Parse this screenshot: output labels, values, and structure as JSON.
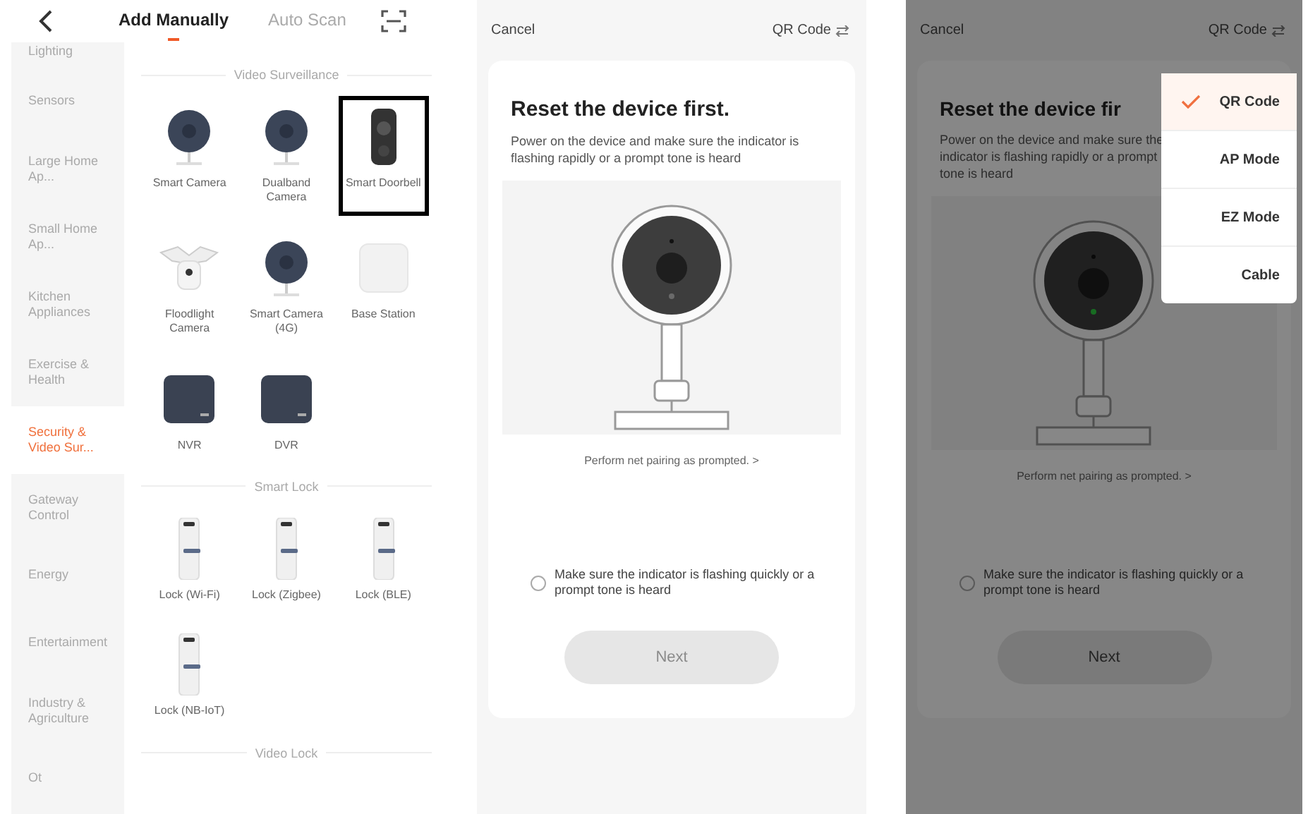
{
  "catalog": {
    "tabs": [
      {
        "label": "Add Manually",
        "selected": true
      },
      {
        "label": "Auto Scan",
        "selected": false
      }
    ],
    "sidebar": [
      {
        "label": "Lighting",
        "selected": false
      },
      {
        "label": "Sensors",
        "selected": false
      },
      {
        "label": "Large Home Ap...",
        "selected": false
      },
      {
        "label": "Small Home Ap...",
        "selected": false
      },
      {
        "label": "Kitchen Appliances",
        "selected": false
      },
      {
        "label": "Exercise & Health",
        "selected": false
      },
      {
        "label": "Security & Video Sur...",
        "selected": true
      },
      {
        "label": "Gateway Control",
        "selected": false
      },
      {
        "label": "Energy",
        "selected": false
      },
      {
        "label": "Entertainment",
        "selected": false
      },
      {
        "label": "Industry & Agriculture",
        "selected": false
      },
      {
        "label": "Ot",
        "selected": false
      }
    ],
    "sections": [
      {
        "title": "Video Surveillance",
        "items": [
          {
            "label": "Smart Camera",
            "kind": "dome",
            "highlighted": false
          },
          {
            "label": "Dualband Camera",
            "kind": "dome",
            "highlighted": false
          },
          {
            "label": "Smart Doorbell",
            "kind": "doorbell",
            "highlighted": true
          },
          {
            "label": "Floodlight Camera",
            "kind": "floodlight",
            "highlighted": false
          },
          {
            "label": "Smart Camera (4G)",
            "kind": "dome",
            "highlighted": false
          },
          {
            "label": "Base Station",
            "kind": "station",
            "highlighted": false
          },
          {
            "label": "NVR",
            "kind": "recorder",
            "highlighted": false
          },
          {
            "label": "DVR",
            "kind": "recorder",
            "highlighted": false
          }
        ]
      },
      {
        "title": "Smart Lock",
        "items": [
          {
            "label": "Lock (Wi-Fi)",
            "kind": "lock",
            "highlighted": false
          },
          {
            "label": "Lock (Zigbee)",
            "kind": "lock",
            "highlighted": false
          },
          {
            "label": "Lock (BLE)",
            "kind": "lock",
            "highlighted": false
          },
          {
            "label": "Lock (NB-IoT)",
            "kind": "lock",
            "highlighted": false
          }
        ]
      },
      {
        "title": "Video Lock"
      }
    ]
  },
  "reset_screens": [
    {
      "dimmed": false,
      "cancel": "Cancel",
      "mode": "QR Code",
      "title": "Reset the device first.",
      "description": "Power on the device and make sure the indicator is flashing rapidly or a prompt tone is heard",
      "indicator_lit": false,
      "link": "Perform net pairing as prompted. >",
      "confirm": {
        "label": "Make sure the indicator is flashing quickly or a prompt tone is heard",
        "checked": false
      },
      "button": {
        "label": "Next",
        "disabled": true
      }
    },
    {
      "dimmed": true,
      "cancel": "Cancel",
      "mode": "QR Code",
      "title": "Reset the device fir",
      "description": "Power on the device and make sure the indicator is flashing rapidly or a prompt tone is heard",
      "indicator_lit": true,
      "link": "Perform net pairing as prompted. >",
      "confirm": {
        "label": "Make sure the indicator is flashing quickly or a prompt tone is heard",
        "checked": false
      },
      "button": {
        "label": "Next",
        "disabled": true
      },
      "menu": [
        {
          "label": "QR Code",
          "selected": true
        },
        {
          "label": "AP Mode",
          "selected": false
        },
        {
          "label": "EZ Mode",
          "selected": false
        },
        {
          "label": "Cable",
          "selected": false
        }
      ]
    }
  ]
}
